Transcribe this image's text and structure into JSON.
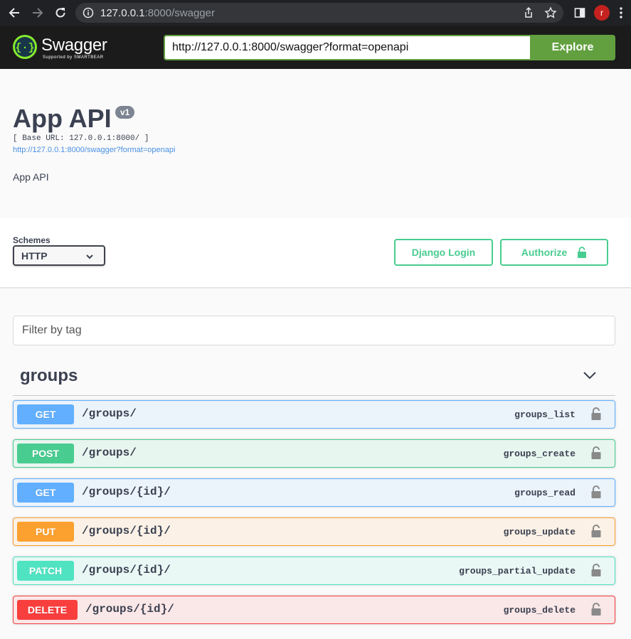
{
  "browser": {
    "url_host": "127.0.0.1",
    "url_rest": ":8000/swagger",
    "avatar_letter": "r"
  },
  "topbar": {
    "logo_text": "Swagger",
    "logo_subtext": "Supported by SMARTBEAR",
    "spec_url": "http://127.0.0.1:8000/swagger?format=openapi",
    "explore_label": "Explore"
  },
  "info": {
    "title": "App API",
    "version": "v1",
    "base_url": "[ Base URL: 127.0.0.1:8000/ ]",
    "spec_link": "http://127.0.0.1:8000/swagger?format=openapi",
    "description": "App API"
  },
  "schemes": {
    "label": "Schemes",
    "selected": "HTTP",
    "django_login_label": "Django Login",
    "authorize_label": "Authorize"
  },
  "filter": {
    "placeholder": "Filter by tag"
  },
  "tag": {
    "name": "groups"
  },
  "operations": [
    {
      "method": "GET",
      "path": "/groups/",
      "operation_id": "groups_list"
    },
    {
      "method": "POST",
      "path": "/groups/",
      "operation_id": "groups_create"
    },
    {
      "method": "GET",
      "path": "/groups/{id}/",
      "operation_id": "groups_read"
    },
    {
      "method": "PUT",
      "path": "/groups/{id}/",
      "operation_id": "groups_update"
    },
    {
      "method": "PATCH",
      "path": "/groups/{id}/",
      "operation_id": "groups_partial_update"
    },
    {
      "method": "DELETE",
      "path": "/groups/{id}/",
      "operation_id": "groups_delete"
    }
  ],
  "colors": {
    "get": "#61affe",
    "post": "#49cc90",
    "put": "#fca130",
    "patch": "#50e3c2",
    "delete": "#f93e3e",
    "accent": "#62a03f"
  }
}
